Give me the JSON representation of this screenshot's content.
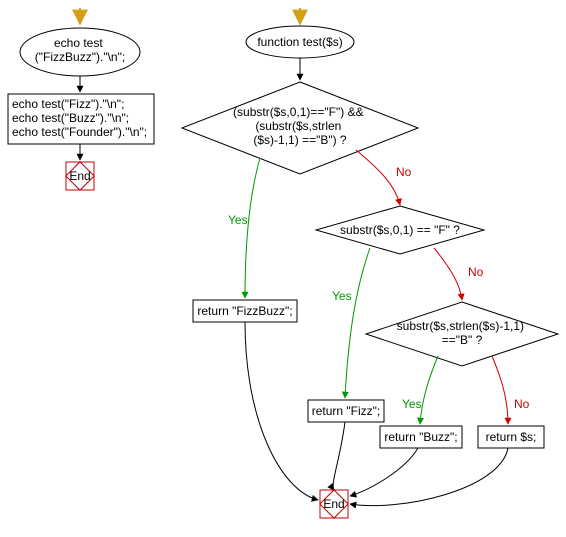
{
  "chart_data": {
    "type": "flowchart",
    "left": {
      "start_arrow": true,
      "terminator": "echo test\n(\"FizzBuzz\").\"\\n\";",
      "process": "echo test(\"Fizz\").\"\\n\";\necho test(\"Buzz\").\"\\n\";\necho test(\"Founder\").\"\\n\";",
      "end": "End"
    },
    "right": {
      "start_arrow": true,
      "terminator": "function test($s)",
      "decision1": "(substr($s,0,1)==\"F\") &&\n(substr($s,strlen\n($s)-1,1) ==\"B\") ?",
      "decision1_yes": "Yes",
      "decision1_no": "No",
      "decision2": "substr($s,0,1) == \"F\" ?",
      "decision2_yes": "Yes",
      "decision2_no": "No",
      "decision3": "substr($s,strlen($s)-1,1)\n==\"B\" ?",
      "decision3_yes": "Yes",
      "decision3_no": "No",
      "ret_fizzbuzz": "return \"FizzBuzz\";",
      "ret_fizz": "return \"Fizz\";",
      "ret_buzz": "return \"Buzz\";",
      "ret_s": "return $s;",
      "end": "End"
    }
  },
  "colors": {
    "start_arrow": "#d4a017",
    "yes": "#009900",
    "no": "#d40000",
    "end_square": "#c00000"
  }
}
